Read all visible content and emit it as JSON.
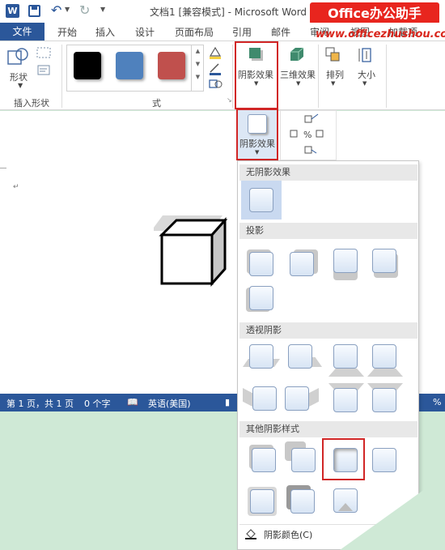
{
  "window": {
    "title": "文档1 [兼容模式] - Microsoft Word",
    "app_logo": "W",
    "watermark_text": "Office办公助手",
    "watermark_url": "www.officezhushou.com"
  },
  "tabs": {
    "file": "文件",
    "items": [
      "开始",
      "插入",
      "设计",
      "页面布局",
      "引用",
      "邮件",
      "审阅",
      "视图",
      "加载项"
    ]
  },
  "ribbon": {
    "shape_label": "形状",
    "insert_shape_group": "插入形状",
    "shadow_effect": "阴影效果",
    "three_d_effect": "三维效果",
    "arrange": "排列",
    "size": "大小",
    "style_group_tail": "式",
    "swatch_colors": [
      "#000000",
      "#4f81bd",
      "#c0504d"
    ]
  },
  "sub_button": {
    "label": "阴影效果"
  },
  "statusbar": {
    "page": "第 1 页，共 1 页",
    "words": "0 个字",
    "language": "英语(美国)",
    "zoom_tail": "%"
  },
  "dropdown": {
    "no_shadow": "无阴影效果",
    "drop_shadow": "投影",
    "perspective": "透视阴影",
    "other_styles": "其他阴影样式",
    "shadow_color": "阴影颜色(C)"
  },
  "colors": {
    "accent": "#2b579a",
    "highlight": "#d12626",
    "background": "#cfe9d6"
  }
}
